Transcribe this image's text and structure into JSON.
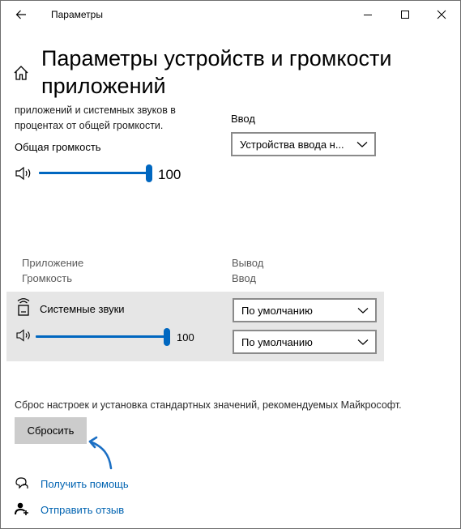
{
  "window": {
    "app_title": "Параметры"
  },
  "page": {
    "title": "Параметры устройств и громкости приложений",
    "description": "приложений и системных звуков в процентах от общей громкости."
  },
  "master": {
    "label": "Общая громкость",
    "value": "100",
    "level": 1.0
  },
  "input": {
    "label": "Ввод",
    "device": "Устройства ввода н..."
  },
  "apps": {
    "column_app": "Приложение",
    "column_volume": "Громкость",
    "column_output": "Вывод",
    "column_input": "Ввод",
    "items": [
      {
        "name": "Системные звуки",
        "value": "100",
        "level": 1.0,
        "output": "По умолчанию",
        "input": "По умолчанию"
      }
    ]
  },
  "reset": {
    "description": "Сброс настроек и установка стандартных значений, рекомендуемых Майкрософт.",
    "button_label": "Сбросить"
  },
  "links": {
    "help": "Получить помощь",
    "feedback": "Отправить отзыв"
  },
  "colors": {
    "accent": "#0067c0",
    "link": "#0063b1",
    "panel": "#e6e6e6",
    "button": "#cccccc"
  },
  "icons": {
    "back": "back-arrow-icon",
    "minimize": "minimize-icon",
    "maximize": "maximize-icon",
    "close": "close-icon",
    "home": "home-icon",
    "speaker": "speaker-icon",
    "app": "system-sounds-icon",
    "chevron": "chevron-down-icon",
    "help": "help-icon",
    "feedback": "feedback-icon",
    "annotation": "annotation-arrow"
  }
}
